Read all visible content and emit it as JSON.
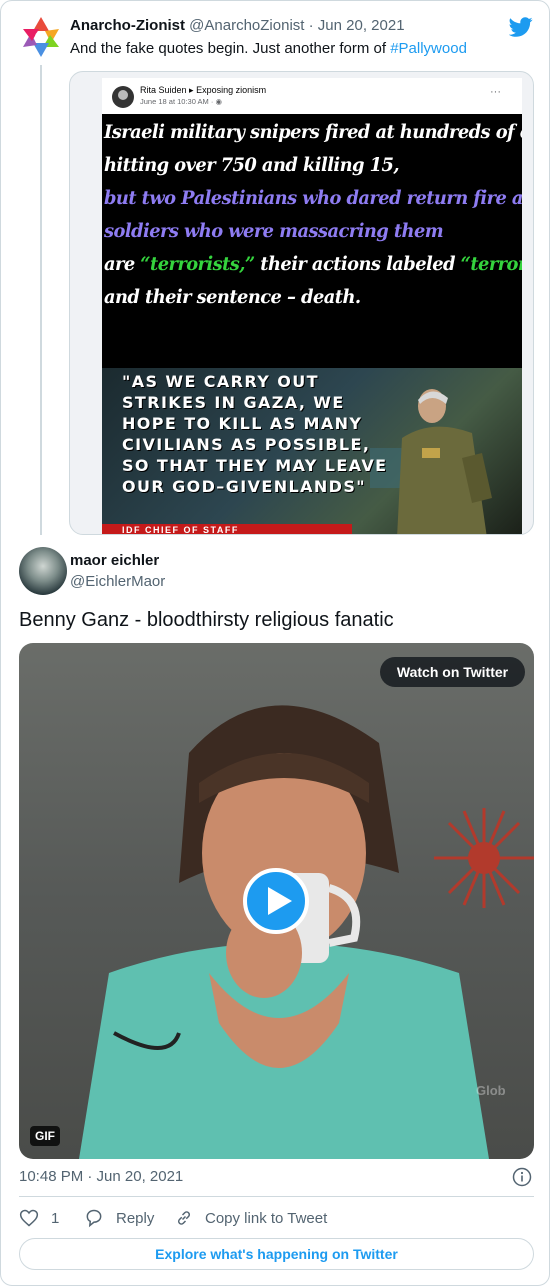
{
  "parent_tweet": {
    "author_name": "Anarcho-Zionist",
    "handle": "@AnarchoZionist",
    "separator": "·",
    "date": "Jun 20, 2021",
    "text": "And the fake quotes begin.  Just another form of ",
    "hashtag": "#Pallywood",
    "avatar_icon": "colorful-star-logo",
    "embedded_image": {
      "fb_author": "Rita Suiden",
      "fb_group": "Exposing zionism",
      "fb_time": "June 18 at 10:30 AM · ",
      "fb_more": "···",
      "meme_lines": [
        {
          "text": "Israeli military snipers fired at hundreds of civilians,",
          "color": "white"
        },
        {
          "text": "hitting over 750 and killing 15,",
          "color": "white"
        },
        {
          "text": "but two Palestinians who dared return fire at the",
          "color": "purple"
        },
        {
          "text": "soldiers who were massacring them",
          "color": "purple"
        },
        {
          "text": "and their sentence – death.",
          "color": "white"
        }
      ],
      "meme_line5_parts": [
        {
          "text": "are ",
          "color": "white"
        },
        {
          "text": "“terrorists,”",
          "color": "green"
        },
        {
          "text": " their actions labeled ",
          "color": "white"
        },
        {
          "text": "“terror attacks”",
          "color": "green"
        }
      ],
      "quote_lines": [
        "\"AS  WE  CARRY  OUT",
        "STRIKES  IN  GAZA,  WE",
        "HOPE TO KILL AS MANY",
        "CIVILIANS AS POSSIBLE,",
        "SO THAT THEY MAY LEAVE",
        "OUR GOD–GIVENLANDS\""
      ],
      "caption": "IDF  CHIEF  OF  STAFF"
    }
  },
  "main_tweet": {
    "author_name": "maor eichler",
    "handle": "@EichlerMaor",
    "text": "Benny Ganz - bloodthirsty religious fanatic",
    "media": {
      "watch_label": "Watch on Twitter",
      "gif_label": "GIF",
      "watermark": "Glob"
    },
    "timestamp": "10:48 PM · Jun 20, 2021",
    "actions": {
      "like_count": "1",
      "reply_label": "Reply",
      "copy_link_label": "Copy link to Tweet"
    },
    "explore_label": "Explore what's happening on Twitter"
  },
  "colors": {
    "twitter_blue": "#1d9bf0",
    "secondary_text": "#536471",
    "border": "#cfd9de",
    "meme_purple": "#8e7cf2",
    "meme_green": "#35d43e",
    "caption_red": "#c51a1a"
  }
}
